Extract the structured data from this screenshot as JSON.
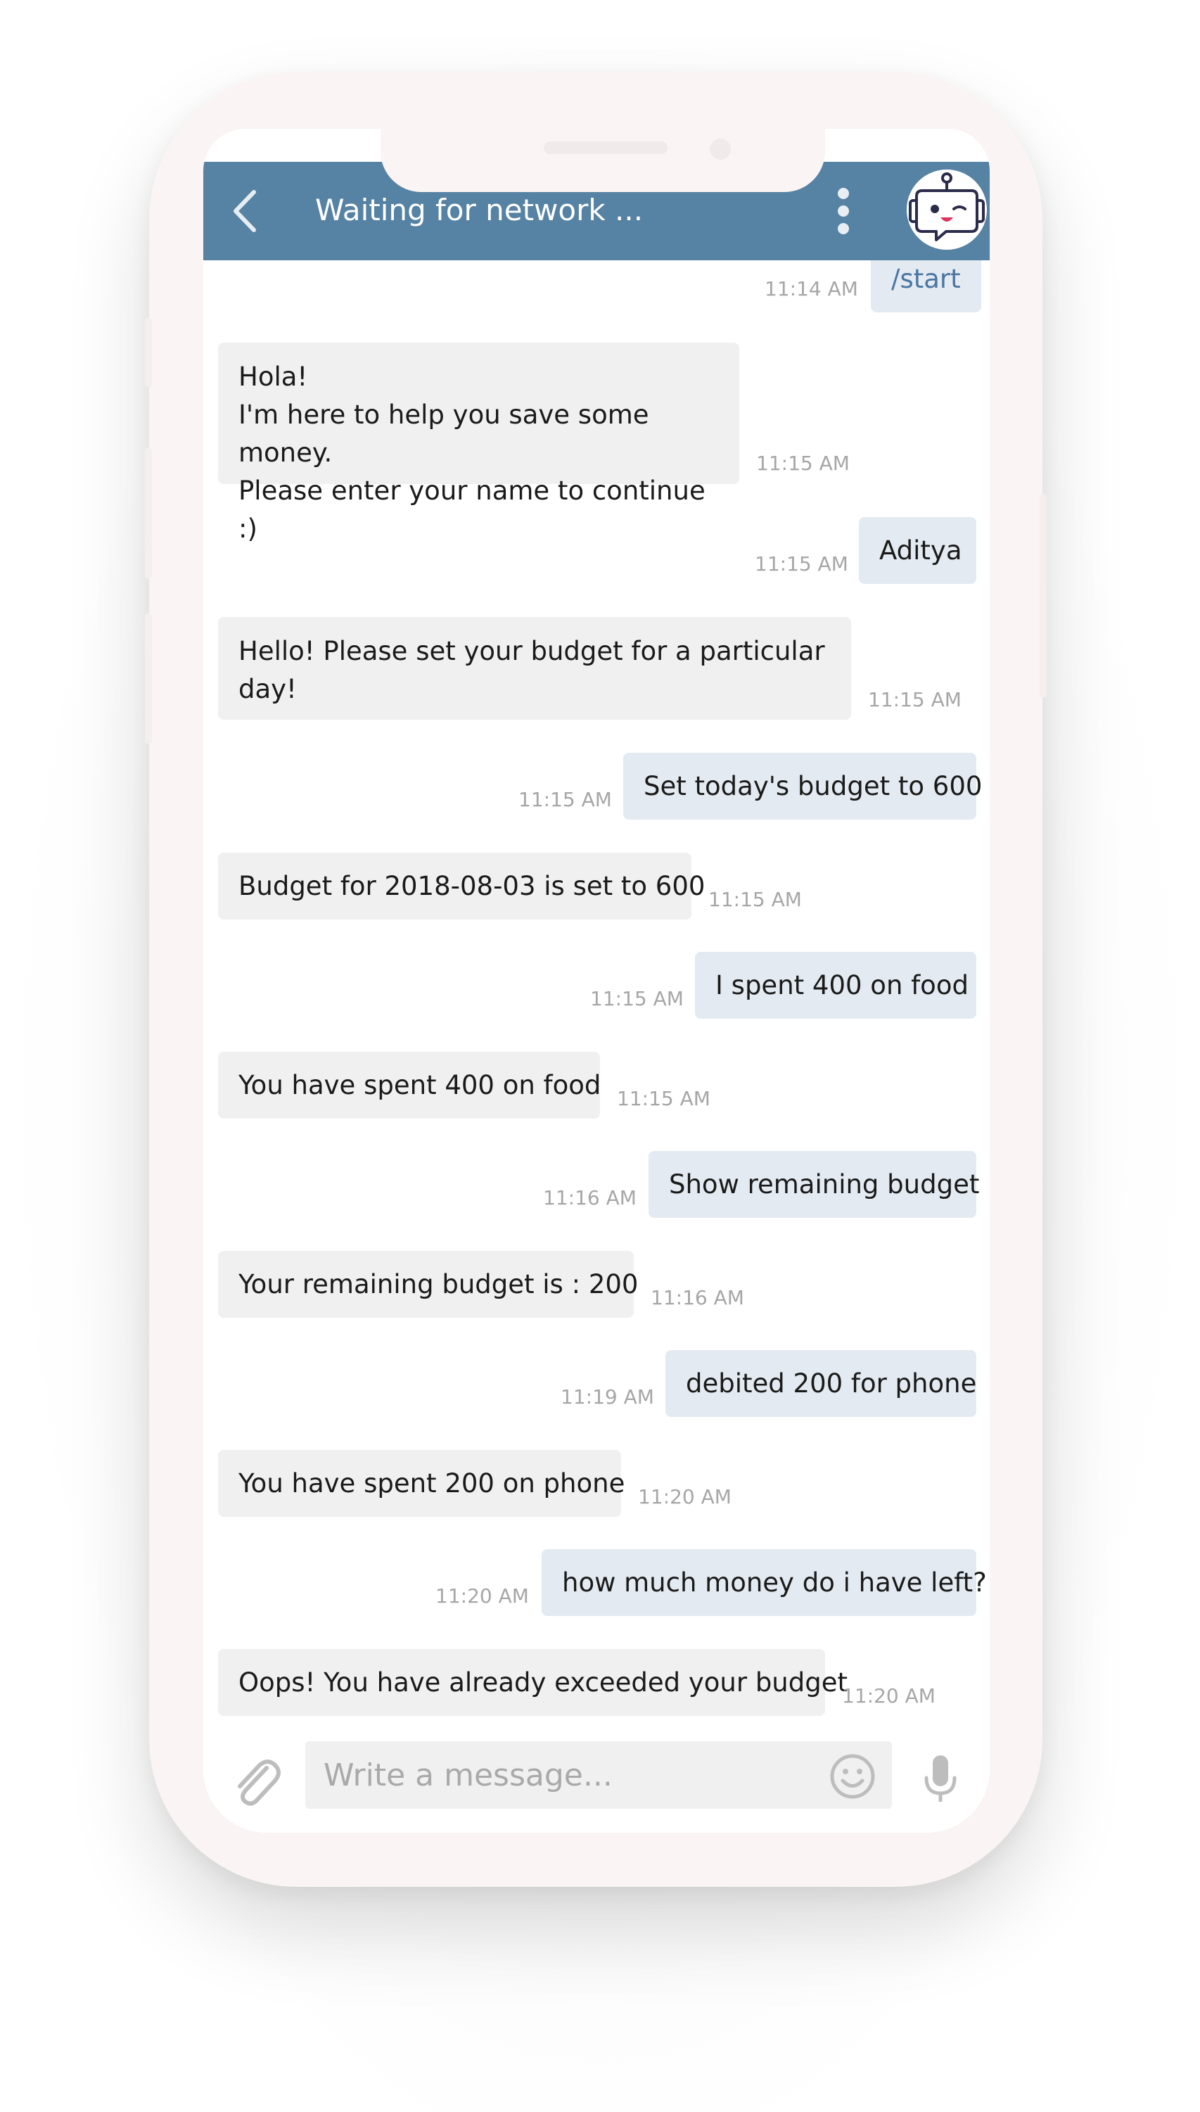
{
  "header": {
    "title": "Waiting for network ...",
    "back_icon": "chevron-left-icon",
    "menu_icon": "vertical-dots-icon",
    "avatar_icon": "robot-icon",
    "color": "#5682a3"
  },
  "messages": [
    {
      "dir": "out",
      "lines": [
        "/start"
      ],
      "time": "11:14 AM",
      "style": "command"
    },
    {
      "dir": "in",
      "lines": [
        "Hola!",
        "I'm here to help you save some money.",
        "Please enter your name to continue :)"
      ],
      "time": "11:15 AM"
    },
    {
      "dir": "out",
      "lines": [
        "Aditya"
      ],
      "time": "11:15 AM"
    },
    {
      "dir": "in",
      "lines": [
        "Hello! Please set your budget for a particular",
        "day!"
      ],
      "time": "11:15 AM"
    },
    {
      "dir": "out",
      "lines": [
        "Set today's budget to 600"
      ],
      "time": "11:15 AM"
    },
    {
      "dir": "in",
      "lines": [
        "Budget for 2018-08-03 is set to 600"
      ],
      "time": "11:15 AM"
    },
    {
      "dir": "out",
      "lines": [
        "I spent 400 on food"
      ],
      "time": "11:15 AM"
    },
    {
      "dir": "in",
      "lines": [
        "You have spent 400 on food"
      ],
      "time": "11:15 AM"
    },
    {
      "dir": "out",
      "lines": [
        "Show remaining budget"
      ],
      "time": "11:16 AM"
    },
    {
      "dir": "in",
      "lines": [
        "Your remaining budget is : 200"
      ],
      "time": "11:16 AM"
    },
    {
      "dir": "out",
      "lines": [
        "debited 200 for phone"
      ],
      "time": "11:19 AM"
    },
    {
      "dir": "in",
      "lines": [
        "You have spent 200 on phone"
      ],
      "time": "11:20 AM"
    },
    {
      "dir": "out",
      "lines": [
        "how much money do i have left?"
      ],
      "time": "11:20 AM"
    },
    {
      "dir": "in",
      "lines": [
        "Oops! You have already exceeded your budget"
      ],
      "time": "11:20 AM"
    }
  ],
  "composer": {
    "placeholder": "Write a message...",
    "attach_icon": "paperclip-icon",
    "emoji_icon": "smiley-icon",
    "mic_icon": "microphone-icon"
  },
  "colors": {
    "incoming_bubble": "#f0f0f0",
    "outgoing_bubble": "#e3eaf1",
    "command_text": "#4a76a1",
    "timestamp": "#a6a6a6"
  }
}
